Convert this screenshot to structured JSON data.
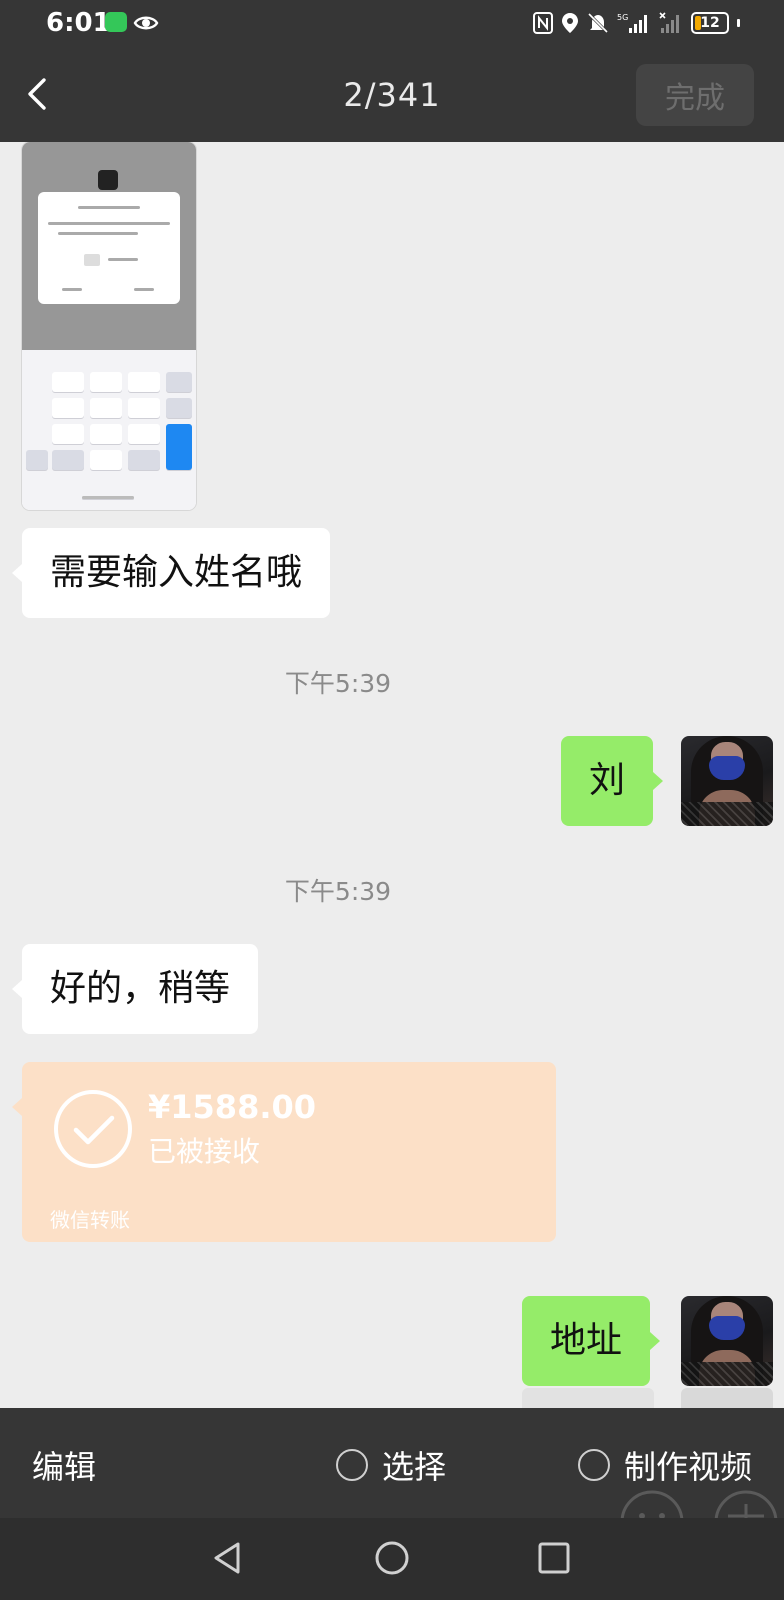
{
  "status_bar": {
    "time": "6:01",
    "battery": "12",
    "network": "5G"
  },
  "header": {
    "counter": "2/341",
    "done_label": "完成"
  },
  "messages": {
    "msg1": "需要输入姓名哦",
    "time1": "下午5:39",
    "msg2": "刘",
    "time2": "下午5:39",
    "msg3": "好的，稍等",
    "msg4": "地址"
  },
  "transfer": {
    "amount": "¥1588.00",
    "status": "已被接收",
    "footer": "微信转账"
  },
  "action_bar": {
    "edit_label": "编辑",
    "select_label": "选择",
    "make_video_label": "制作视频"
  },
  "colors": {
    "bar_bg": "#363636",
    "chat_bg": "#ededed",
    "sent_bubble": "#95ec69",
    "transfer_card": "#fce0c7"
  }
}
